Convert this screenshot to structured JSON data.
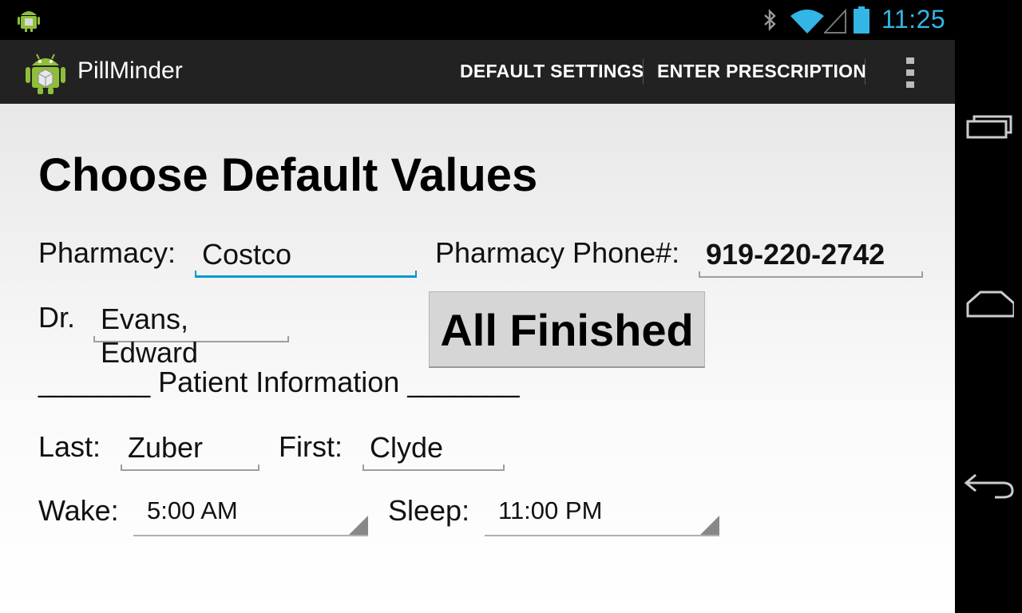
{
  "status_bar": {
    "time": "11:25",
    "icons": [
      "android-icon",
      "bluetooth-icon",
      "wifi-icon",
      "signal-icon",
      "battery-icon"
    ],
    "accent_color": "#33b5e5"
  },
  "action_bar": {
    "title": "PillMinder",
    "actions": [
      "DEFAULT SETTINGS",
      "ENTER PRESCRIPTION"
    ],
    "overflow_icon": "more-vert-icon"
  },
  "form": {
    "heading": "Choose Default Values",
    "pharmacy_label": "Pharmacy:",
    "pharmacy_value": "Costco",
    "phone_label": "Pharmacy Phone#:",
    "phone_value": "919-220-2742",
    "doctor_label": "Dr.",
    "doctor_value": "Evans, Edward",
    "finished_button": "All Finished",
    "patient_section": "_______ Patient Information _______",
    "last_label": "Last:",
    "last_value": "Zuber",
    "first_label": "First:",
    "first_value": "Clyde",
    "wake_label": "Wake:",
    "wake_value": "5:00 AM",
    "sleep_label": "Sleep:",
    "sleep_value": "11:00 PM",
    "focus_color": "#0099cc"
  },
  "nav_bar": {
    "buttons": [
      "recent-apps-icon",
      "home-icon",
      "back-icon"
    ]
  }
}
